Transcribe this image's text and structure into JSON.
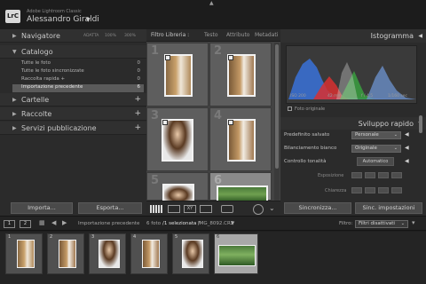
{
  "header": {
    "logo_text": "LrC",
    "app_name": "Adobe Lightroom Classic",
    "user_name": "Alessandro Giraldi",
    "user_caret": "▼",
    "top_arrow": "▲"
  },
  "left": {
    "navigator": {
      "label": "Navigatore",
      "opt1": "ADATTA",
      "opt2": "100%",
      "opt3": "300%"
    },
    "catalog": {
      "label": "Catalogo",
      "items": [
        {
          "label": "Tutte le foto",
          "count": "0"
        },
        {
          "label": "Tutte le foto sincronizzate",
          "count": "0"
        },
        {
          "label": "Raccolta rapida +",
          "count": "0"
        },
        {
          "label": "Importazione precedente",
          "count": "6"
        }
      ]
    },
    "sections": [
      {
        "label": "Cartelle",
        "action": "+"
      },
      {
        "label": "Raccolte",
        "action": "+"
      },
      {
        "label": "Servizi pubblicazione",
        "action": "+"
      }
    ],
    "import_button": "Importa...",
    "export_button": "Esporta..."
  },
  "center": {
    "filter_bar": {
      "title": "Filtro Libreria :",
      "tab1": "Testo",
      "tab2": "Attributo",
      "tab3": "Metadati"
    },
    "grid_numbers": [
      "1",
      "2",
      "3",
      "4",
      "5",
      "6"
    ]
  },
  "right": {
    "histogram": {
      "label": "Istogramma",
      "iso": "ISO 200",
      "focal": "42 mm",
      "aperture": "f / 4,5",
      "shutter": "1/160 sec",
      "original_photo": "Foto originale"
    },
    "quick_develop": {
      "label": "Sviluppo rapido",
      "preset_label": "Predefinito salvato",
      "preset_value": "Personale",
      "wb_label": "Bilanciamento bianco",
      "wb_value": "Originale",
      "tone_label": "Controllo tonalità",
      "tone_value": "Automatico",
      "exposure_label": "Esposizione",
      "clarity_label": "Chiarezza"
    },
    "sync_button": "Sincronizza...",
    "sync_settings_button": "Sinc. impostazioni"
  },
  "filmstrip_bar": {
    "view1": "1",
    "view2": "2",
    "source": "Importazione precedente",
    "count_text": "6 foto",
    "sel_text": "/1 selezionata /",
    "file_name": "IMG_8092.CR2",
    "file_caret": "▼",
    "filter_label": "Filtro:",
    "filter_value": "Filtri disattivati"
  },
  "filmstrip": {
    "numbers": [
      "1",
      "2",
      "3",
      "4",
      "5",
      "6"
    ]
  },
  "colors": {
    "panel": "#2b2b2b",
    "center": "#434343",
    "selected_row": "#5a5a5a"
  }
}
